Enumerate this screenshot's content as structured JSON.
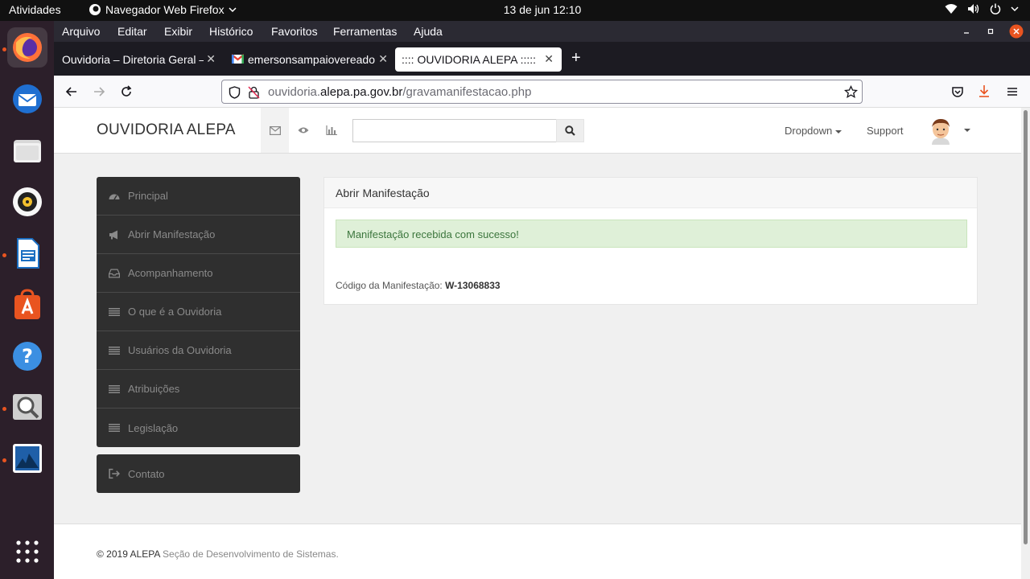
{
  "system": {
    "activities": "Atividades",
    "app_menu": "Navegador Web Firefox",
    "clock": "13 de jun  12:10"
  },
  "browser": {
    "menu": [
      "Arquivo",
      "Editar",
      "Exibir",
      "Histórico",
      "Favoritos",
      "Ferramentas",
      "Ajuda"
    ],
    "tabs": [
      {
        "label": "Ouvidoria – Diretoria Geral –"
      },
      {
        "label": "emersonsampaiovereado"
      },
      {
        "label": ":::: OUVIDORIA ALEPA :::::"
      }
    ],
    "new_tab": "+",
    "url": {
      "prefix": "ouvidoria.",
      "domain": "alepa.pa.gov.br",
      "path": "/gravamanifestacao.php"
    }
  },
  "site": {
    "brand": "OUVIDORIA ALEPA",
    "search_placeholder": "",
    "nav": {
      "dropdown": "Dropdown",
      "support": "Support"
    },
    "sidebar": [
      {
        "label": "Principal",
        "icon": "dashboard-icon"
      },
      {
        "label": "Abrir Manifestação",
        "icon": "bullhorn-icon"
      },
      {
        "label": "Acompanhamento",
        "icon": "inbox-icon"
      },
      {
        "label": "O que é a Ouvidoria",
        "icon": "list-icon"
      },
      {
        "label": "Usuários da Ouvidoria",
        "icon": "list-icon"
      },
      {
        "label": "Atribuições",
        "icon": "list-icon"
      },
      {
        "label": "Legislação",
        "icon": "list-icon"
      }
    ],
    "contact": {
      "label": "Contato",
      "icon": "sign-out-icon"
    },
    "panel": {
      "title": "Abrir Manifestação",
      "alert": "Manifestação recebida com sucesso!",
      "code_label": "Código da Manifestação:",
      "code_value": "W-13068833"
    },
    "footer": {
      "copyright": "© 2019 ALEPA",
      "text": "Seção de Desenvolvimento de Sistemas."
    }
  }
}
